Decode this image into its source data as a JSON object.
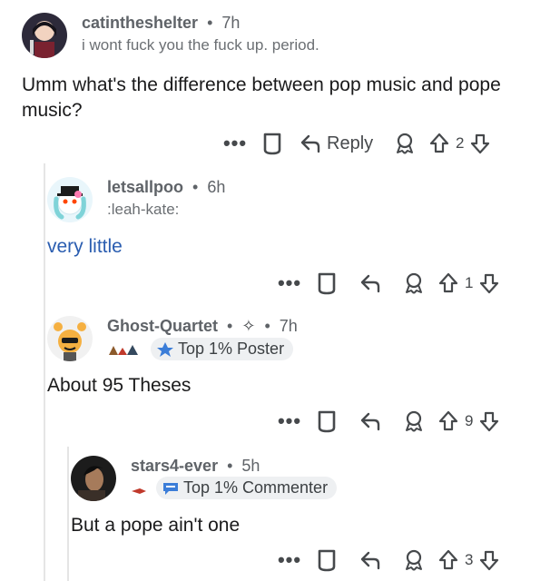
{
  "comments": [
    {
      "username": "catintheshelter",
      "age": "7h",
      "flair": "i wont fuck you the fuck up. period.",
      "body": "Umm what's the difference between pop music and pope music?",
      "reply_label": "Reply",
      "score": "2",
      "colors": {
        "avatar_bg": "#2d2a3a"
      }
    },
    {
      "username": "letsallpoo",
      "age": "6h",
      "flair": ":leah-kate:",
      "body": "very little",
      "score": "1",
      "colors": {
        "avatar_bg": "#e9f6fb",
        "body": "#2a5db0"
      }
    },
    {
      "username": "Ghost-Quartet",
      "age": "7h",
      "badge": "Top 1% Poster",
      "body": "About 95 Theses",
      "score": "9",
      "colors": {
        "avatar_bg": "#f1f1f1"
      }
    },
    {
      "username": "stars4-ever",
      "age": "5h",
      "badge": "Top 1% Commenter",
      "body": "But a pope ain't one",
      "score": "3",
      "colors": {
        "avatar_bg": "#1c1c1c"
      }
    }
  ],
  "separator": "•",
  "more_label": "•••",
  "icons": [
    "more-icon",
    "bookmark-icon",
    "reply-icon",
    "award-icon",
    "upvote-icon",
    "downvote-icon"
  ]
}
